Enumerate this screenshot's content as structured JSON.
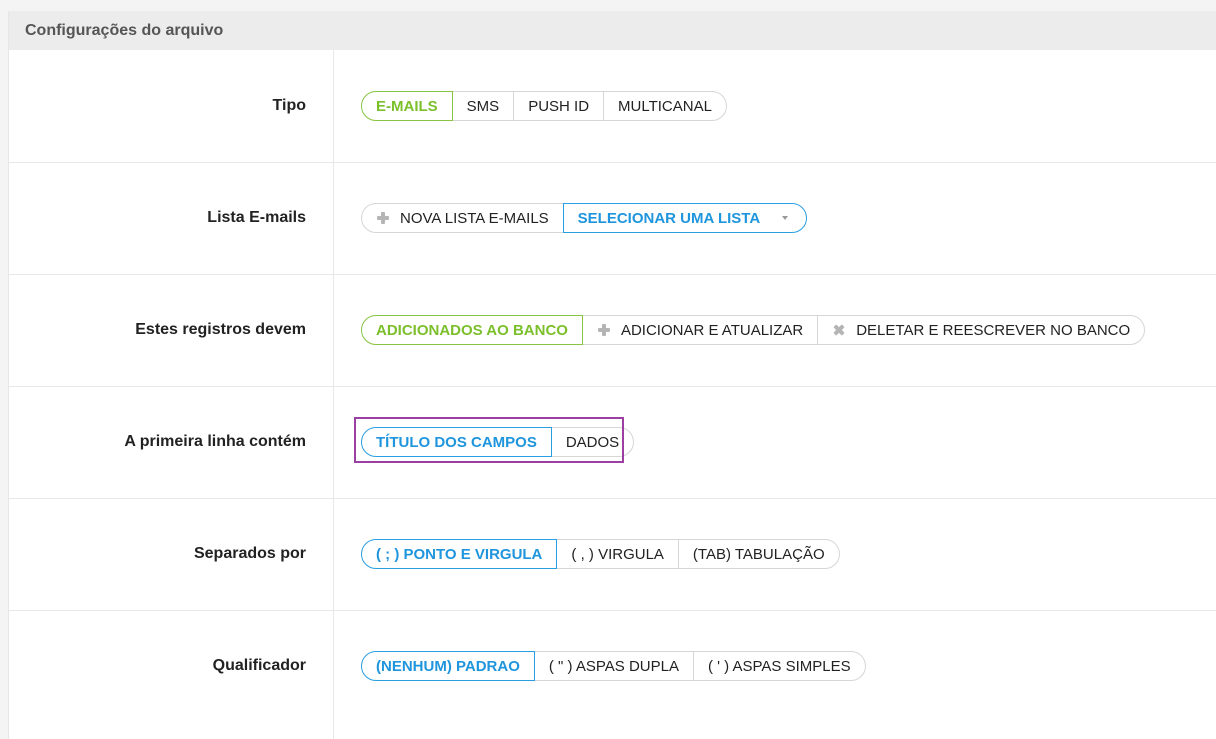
{
  "panel": {
    "title": "Configurações do arquivo"
  },
  "rows": [
    {
      "label": "Tipo",
      "options": [
        "E-MAILS",
        "SMS",
        "PUSH ID",
        "MULTICANAL"
      ],
      "selected": "E-MAILS"
    },
    {
      "label": "Lista E-mails",
      "options": [
        "NOVA LISTA E-MAILS",
        "SELECIONAR UMA LISTA"
      ],
      "selected": "SELECIONAR UMA LISTA"
    },
    {
      "label": "Estes registros devem",
      "options": [
        "ADICIONADOS AO BANCO",
        "ADICIONAR E ATUALIZAR",
        "DELETAR E REESCREVER NO BANCO"
      ],
      "selected": "ADICIONADOS AO BANCO"
    },
    {
      "label": "A primeira linha contém",
      "options": [
        "TÍTULO DOS CAMPOS",
        "DADOS"
      ],
      "selected": "TÍTULO DOS CAMPOS"
    },
    {
      "label": "Separados por",
      "options": [
        "( ; ) PONTO E VIRGULA",
        "( , ) VIRGULA",
        "(TAB) TABULAÇÃO"
      ],
      "selected": "( ; ) PONTO E VIRGULA"
    },
    {
      "label": "Qualificador",
      "options": [
        "(NENHUM) PADRAO",
        "( \" ) ASPAS DUPLA",
        "( ' ) ASPAS SIMPLES"
      ],
      "selected": "(NENHUM) PADRAO"
    }
  ],
  "colors": {
    "active_green": "#7cbf2c",
    "active_blue": "#1f95dd",
    "highlight_border": "#9b3fa3"
  }
}
